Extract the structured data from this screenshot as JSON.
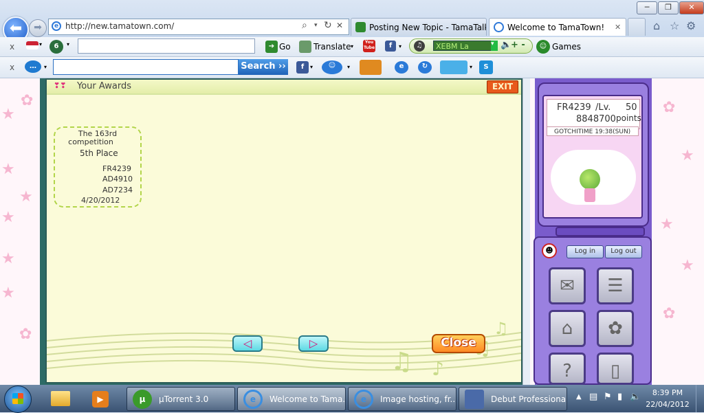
{
  "browser": {
    "address": "http://new.tamatown.com/",
    "address_icons": [
      "search-icon",
      "dropdown-icon",
      "refresh-icon",
      "stop-icon"
    ],
    "tabs": [
      {
        "label": "Posting New Topic - TamaTalk",
        "active": false
      },
      {
        "label": "Welcome to TamaTown!",
        "active": true
      }
    ],
    "tab_close": "✕",
    "window_controls": {
      "minimize": "─",
      "maximize": "❐",
      "close": "✕"
    }
  },
  "toolbar1": {
    "close": "x",
    "go_label": "Go",
    "translate_label": "Translate",
    "youtube_label": "You Tube",
    "radio_station": "XEBM La",
    "games_label": "Games",
    "radio_controls": "+ -"
  },
  "toolbar2": {
    "close": "x",
    "search_label": "Search ››"
  },
  "awards": {
    "title": "Your Awards",
    "exit_label": "EXIT",
    "card": {
      "competition": "The 163rd",
      "competition_line2": "competition",
      "place": "5th Place",
      "ids": [
        "FR4239",
        "AD4910",
        "AD7234"
      ],
      "date": "4/20/2012"
    },
    "prev_symbol": "◁",
    "next_symbol": "▷",
    "close_label": "Close"
  },
  "device": {
    "user_id": "FR4239",
    "level_label": "/Lv.",
    "level": "50",
    "points": "8848700",
    "points_label": "points",
    "gotchi_time": "GOTCHITIME 19:38(SUN)",
    "login_label": "Log in",
    "logout_label": "Log out"
  },
  "taskbar": {
    "items": [
      {
        "label": "µTorrent 3.0"
      },
      {
        "label": "Welcome to Tama..."
      },
      {
        "label": "Image hosting, fr..."
      },
      {
        "label": "Debut Professional"
      }
    ],
    "time": "8:39 PM",
    "date": "22/04/2012"
  },
  "colors": {
    "accent": "#1f5dc8",
    "game_bg": "#fbfbd9",
    "exit": "#e85a1c",
    "close": "#ff8a24",
    "device": "#7a5ccc"
  }
}
